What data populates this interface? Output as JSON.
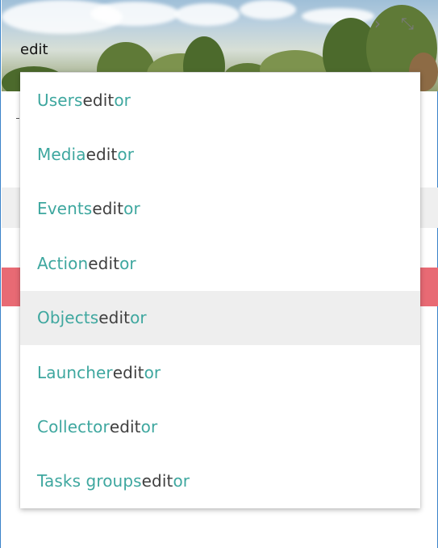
{
  "search": {
    "value": "edit"
  },
  "header_icons": {
    "forward": "chevron-right-icon",
    "collapse": "collapse-arrows-icon"
  },
  "dropdown": {
    "items": [
      {
        "prefix": "Users ",
        "match": "edit",
        "suffix": "or"
      },
      {
        "prefix": "Media ",
        "match": "edit",
        "suffix": "or"
      },
      {
        "prefix": "Events ",
        "match": "edit",
        "suffix": "or"
      },
      {
        "prefix": "Action ",
        "match": "edit",
        "suffix": "or"
      },
      {
        "prefix": "Objects ",
        "match": "edit",
        "suffix": "or"
      },
      {
        "prefix": "Launcher ",
        "match": "edit",
        "suffix": "or"
      },
      {
        "prefix": "Collector ",
        "match": "edit",
        "suffix": "or"
      },
      {
        "prefix": "Tasks groups ",
        "match": "edit",
        "suffix": "or"
      }
    ],
    "selected_index": 4
  },
  "colors": {
    "accent": "#3ea79f",
    "match_text": "#3f3f3f",
    "highlight_bg": "#eeeeee",
    "alert_strip": "#e86a74",
    "window_border": "#3b83c9"
  }
}
